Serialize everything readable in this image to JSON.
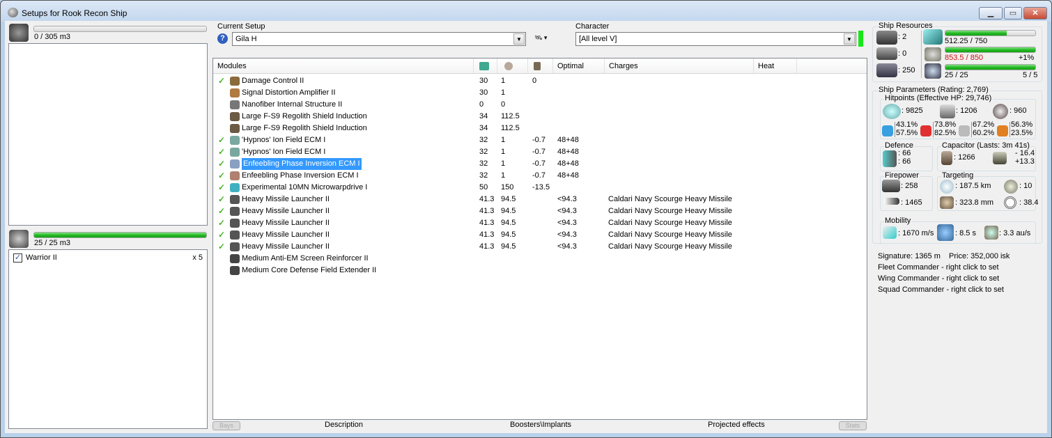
{
  "window": {
    "title": "Setups for Rook Recon Ship",
    "min": "▁",
    "max": "▭",
    "close": "✕"
  },
  "cargo": {
    "usage": "0 / 305 m3",
    "fraction": 0
  },
  "drones": {
    "usage": "25 / 25 m3",
    "fraction": 1,
    "items": [
      {
        "name": "Warrior II",
        "count": "x 5",
        "checked": true
      }
    ]
  },
  "setup": {
    "label": "Current Setup",
    "value": "Gila H",
    "help": "?"
  },
  "character": {
    "label": "Character",
    "value": "[All level V]"
  },
  "columns": {
    "modules": "Modules",
    "optimal": "Optimal",
    "charges": "Charges",
    "heat": "Heat"
  },
  "modules": [
    {
      "check": true,
      "name": "Damage Control II",
      "cpu": "30",
      "pg": "1",
      "cap": "0",
      "optimal": "",
      "charges": "",
      "icon": "#8a6a3a"
    },
    {
      "check": false,
      "name": "Signal Distortion Amplifier II",
      "cpu": "30",
      "pg": "1",
      "cap": "",
      "optimal": "",
      "charges": "",
      "icon": "#b07a40"
    },
    {
      "check": false,
      "name": "Nanofiber Internal Structure II",
      "cpu": "0",
      "pg": "0",
      "cap": "",
      "optimal": "",
      "charges": "",
      "icon": "#777"
    },
    {
      "check": false,
      "name": "Large F-S9 Regolith Shield Induction",
      "cpu": "34",
      "pg": "112.5",
      "cap": "",
      "optimal": "",
      "charges": "",
      "icon": "#6b5a44"
    },
    {
      "check": false,
      "name": "Large F-S9 Regolith Shield Induction",
      "cpu": "34",
      "pg": "112.5",
      "cap": "",
      "optimal": "",
      "charges": "",
      "icon": "#6b5a44"
    },
    {
      "check": true,
      "name": "'Hypnos' Ion Field ECM I",
      "cpu": "32",
      "pg": "1",
      "cap": "-0.7",
      "optimal": "48+48",
      "charges": "",
      "icon": "#7aa8a0"
    },
    {
      "check": true,
      "name": "'Hypnos' Ion Field ECM I",
      "cpu": "32",
      "pg": "1",
      "cap": "-0.7",
      "optimal": "48+48",
      "charges": "",
      "icon": "#7aa8a0"
    },
    {
      "check": true,
      "name": "Enfeebling Phase Inversion ECM I",
      "cpu": "32",
      "pg": "1",
      "cap": "-0.7",
      "optimal": "48+48",
      "charges": "",
      "icon": "#8aa0c0",
      "selected": true
    },
    {
      "check": true,
      "name": "Enfeebling Phase Inversion ECM I",
      "cpu": "32",
      "pg": "1",
      "cap": "-0.7",
      "optimal": "48+48",
      "charges": "",
      "icon": "#b08070"
    },
    {
      "check": true,
      "name": "Experimental 10MN Microwarpdrive I",
      "cpu": "50",
      "pg": "150",
      "cap": "-13.5",
      "optimal": "",
      "charges": "",
      "icon": "#40b0c0"
    },
    {
      "check": true,
      "name": "Heavy Missile Launcher II",
      "cpu": "41.3",
      "pg": "94.5",
      "cap": "",
      "optimal": "<94.3",
      "charges": "Caldari Navy Scourge Heavy Missile",
      "icon": "#555"
    },
    {
      "check": true,
      "name": "Heavy Missile Launcher II",
      "cpu": "41.3",
      "pg": "94.5",
      "cap": "",
      "optimal": "<94.3",
      "charges": "Caldari Navy Scourge Heavy Missile",
      "icon": "#555"
    },
    {
      "check": true,
      "name": "Heavy Missile Launcher II",
      "cpu": "41.3",
      "pg": "94.5",
      "cap": "",
      "optimal": "<94.3",
      "charges": "Caldari Navy Scourge Heavy Missile",
      "icon": "#555"
    },
    {
      "check": true,
      "name": "Heavy Missile Launcher II",
      "cpu": "41.3",
      "pg": "94.5",
      "cap": "",
      "optimal": "<94.3",
      "charges": "Caldari Navy Scourge Heavy Missile",
      "icon": "#555"
    },
    {
      "check": true,
      "name": "Heavy Missile Launcher II",
      "cpu": "41.3",
      "pg": "94.5",
      "cap": "",
      "optimal": "<94.3",
      "charges": "Caldari Navy Scourge Heavy Missile",
      "icon": "#555"
    },
    {
      "check": false,
      "name": "Medium Anti-EM Screen Reinforcer II",
      "cpu": "",
      "pg": "",
      "cap": "",
      "optimal": "",
      "charges": "",
      "icon": "#444"
    },
    {
      "check": false,
      "name": "Medium Core Defense Field Extender II",
      "cpu": "",
      "pg": "",
      "cap": "",
      "optimal": "",
      "charges": "",
      "icon": "#444"
    }
  ],
  "tabs": {
    "bays": "Bays",
    "description": "Description",
    "boosters": "Boosters\\Implants",
    "projected": "Projected effects",
    "stats": "Stats"
  },
  "resources": {
    "title": "Ship Resources",
    "turrets": ": 2",
    "launchers": ": 0",
    "calibration": ": 250",
    "cpu": {
      "text": "512.25 / 750",
      "fraction": 0.683
    },
    "pg": {
      "text": "853.5 / 850",
      "extra": "+1%",
      "fraction": 1
    },
    "drone_bw": {
      "text": "25 / 25",
      "extra": "5 / 5",
      "fraction": 1
    }
  },
  "params": {
    "title": "Ship Parameters (Rating: 2,769)",
    "hp_title": "Hitpoints (Effective HP: 29,746)",
    "shield": ": 9825",
    "armor": ": 1206",
    "structure": ": 960",
    "resists": [
      [
        "43.1%",
        "57.5%"
      ],
      [
        "73.8%",
        "82.5%"
      ],
      [
        "67.2%",
        "60.2%"
      ],
      [
        "56.3%",
        "23.5%"
      ]
    ],
    "defence_title": "Defence",
    "defence": [
      ": 66",
      ": 66"
    ],
    "cap_title": "Capacitor (Lasts: 3m 41s)",
    "cap": ": 1266",
    "cap_delta": [
      "- 16.4",
      "+13.3"
    ],
    "fire_title": "Firepower",
    "turret_dps": ": 258",
    "missile_dps": ": 1465",
    "target_title": "Targeting",
    "range": ": 187.5 km",
    "targets": ": 10",
    "sensor": ": 323.8 mm",
    "scan": ": 38.4",
    "mob_title": "Mobility",
    "speed": ": 1670 m/s",
    "align": ": 8.5 s",
    "warp": ": 3.3 au/s",
    "signature": "Signature: 1365 m",
    "price": "Price: 352,000 isk",
    "fleet": "Fleet Commander - right click to set",
    "wing": "Wing Commander - right click to set",
    "squad": "Squad Commander - right click to set"
  }
}
